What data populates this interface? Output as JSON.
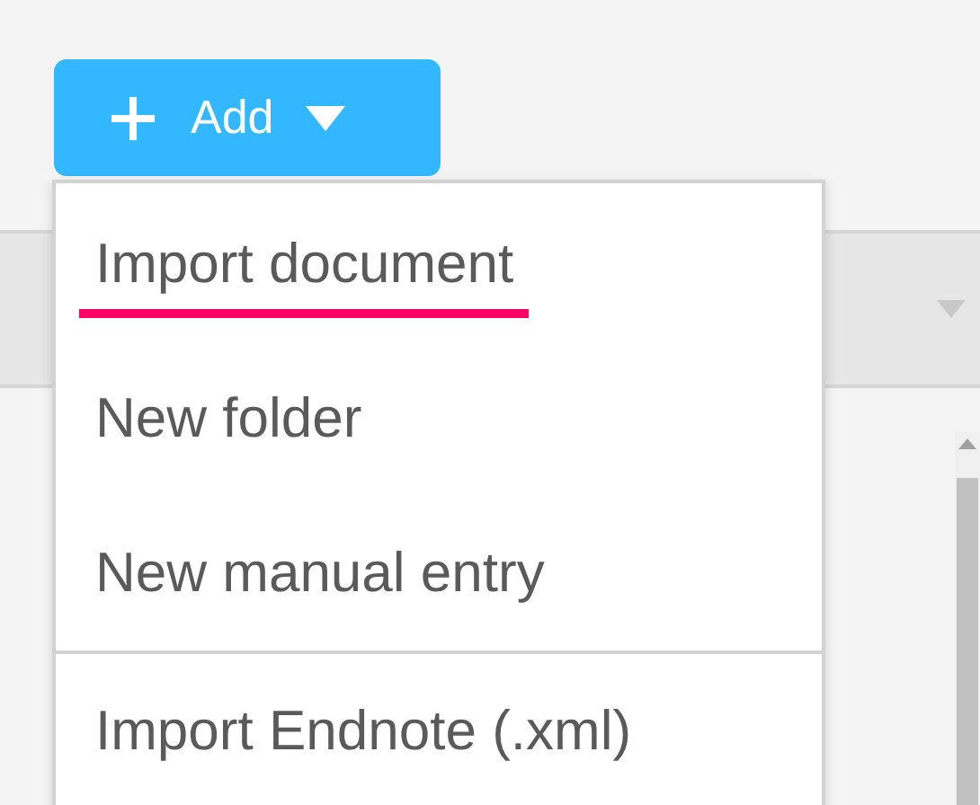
{
  "add_button": {
    "label": "Add"
  },
  "menu": {
    "sections": [
      {
        "items": [
          {
            "label": "Import document",
            "underlined": true
          },
          {
            "label": "New folder",
            "underlined": false
          },
          {
            "label": "New manual entry",
            "underlined": false
          }
        ]
      },
      {
        "items": [
          {
            "label": "Import Endnote (.xml)",
            "underlined": false
          }
        ]
      }
    ]
  }
}
